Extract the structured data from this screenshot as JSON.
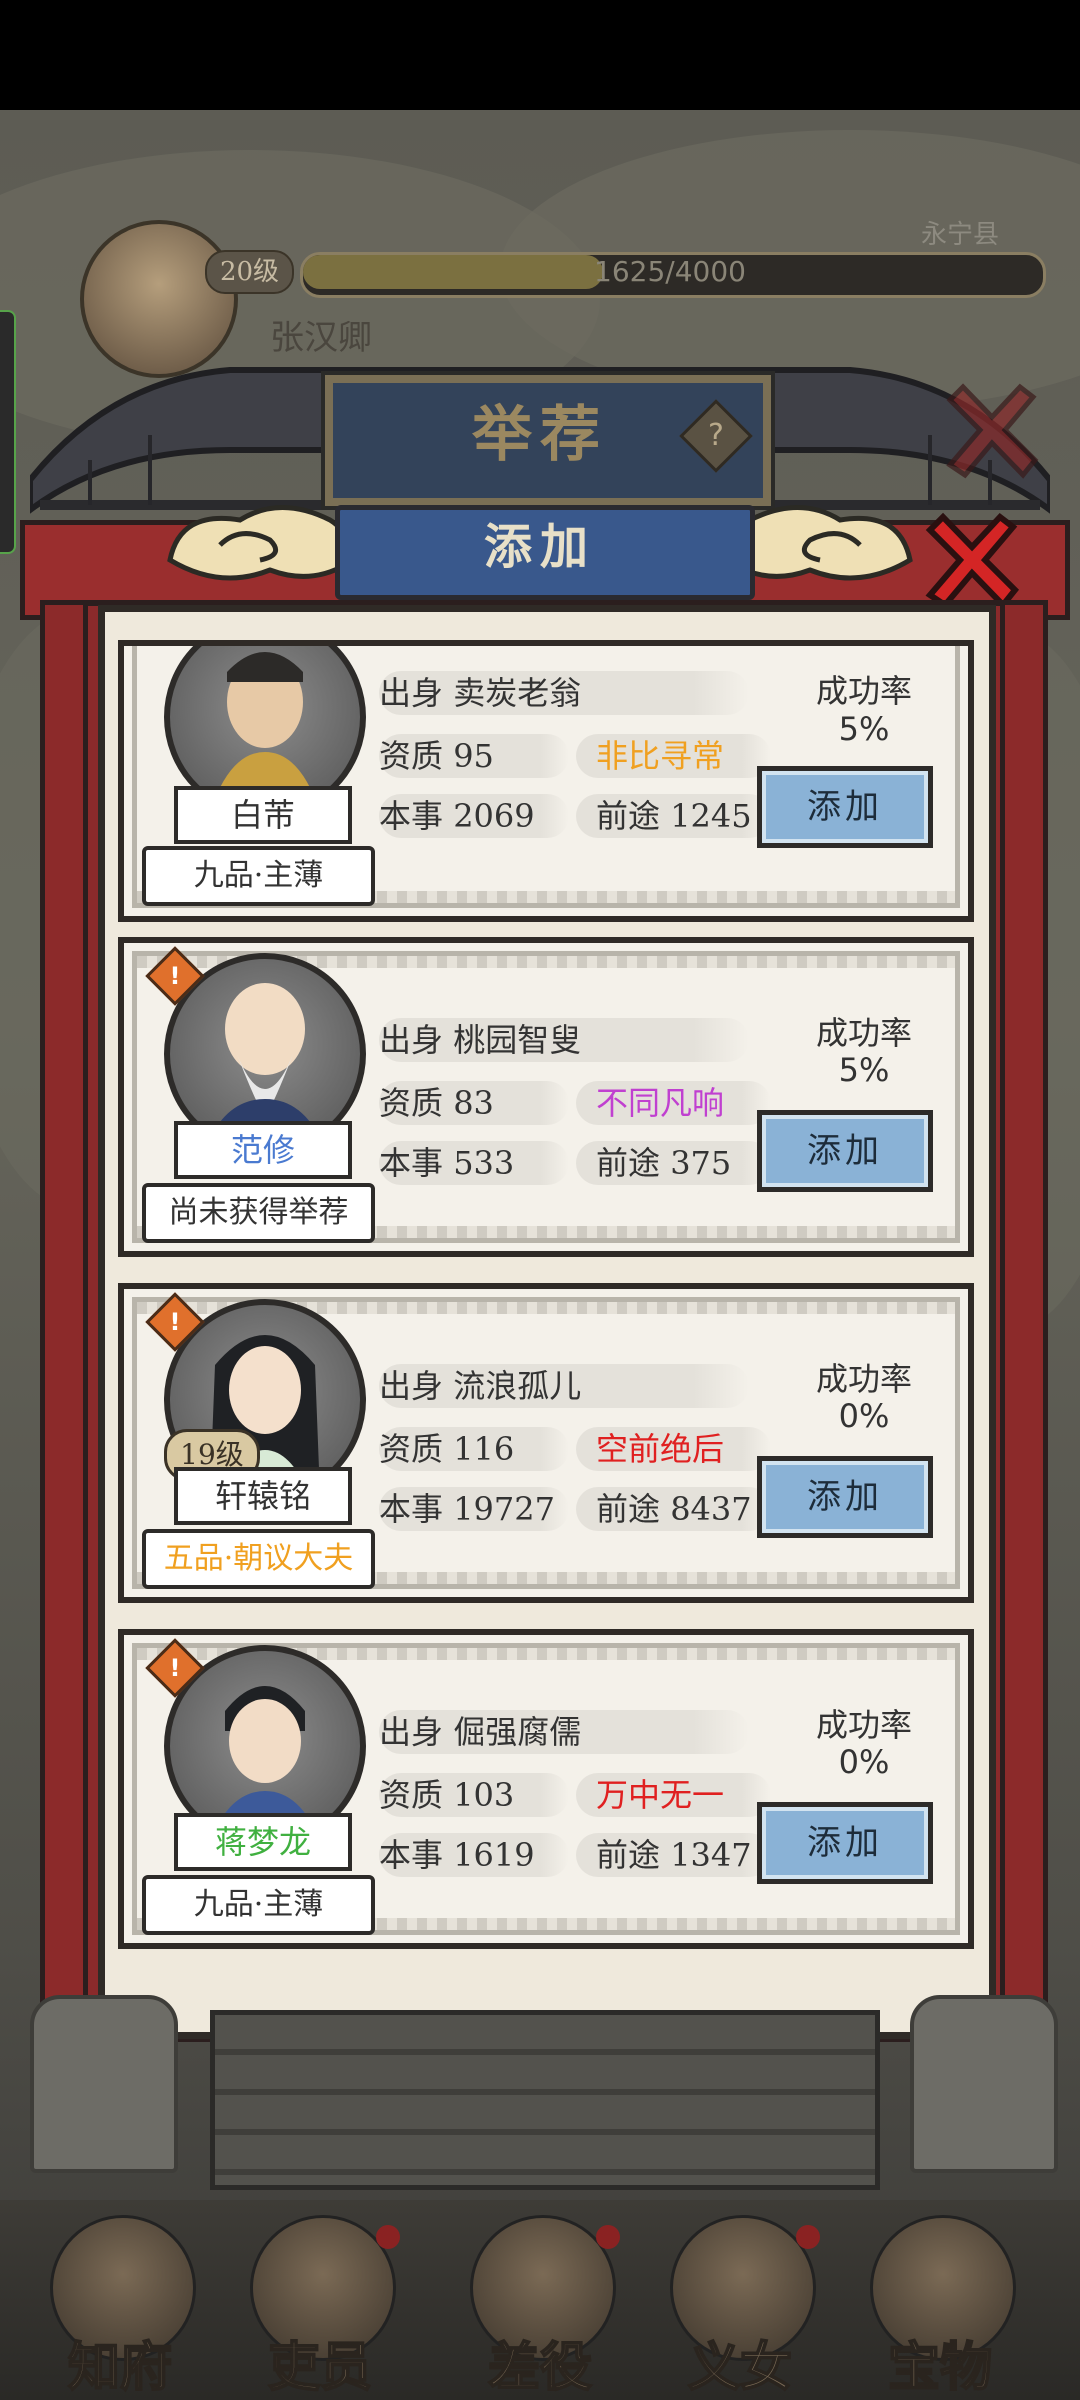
{
  "background": {
    "player_level": "20级",
    "exp_text": "1625/4000",
    "exp_progress": 0.406,
    "county": "永宁县",
    "player_name": "张汉卿"
  },
  "dialog": {
    "title": "举荐",
    "help_icon": "question-icon",
    "subtitle": "添加",
    "close_icon": "close-x-icon"
  },
  "candidates": [
    {
      "origin_label": "出身",
      "origin": "卖炭老翁",
      "aptitude_label": "资质",
      "aptitude": "95",
      "grade": "非比寻常",
      "grade_color": "#f0a020",
      "skill_label": "本事",
      "skill": "2069",
      "prospect_label": "前途",
      "prospect": "1245",
      "name": "白芾",
      "name_color": "#333333",
      "rank": "九品·主薄",
      "rank_color": "#333333",
      "success_label": "成功率",
      "success_rate": "5%",
      "button": "添加",
      "has_warning": false,
      "level": ""
    },
    {
      "origin_label": "出身",
      "origin": "桃园智叟",
      "aptitude_label": "资质",
      "aptitude": "83",
      "grade": "不同凡响",
      "grade_color": "#c040d0",
      "skill_label": "本事",
      "skill": "533",
      "prospect_label": "前途",
      "prospect": "375",
      "name": "范修",
      "name_color": "#4a7ad0",
      "rank": "尚未获得举荐",
      "rank_color": "#333333",
      "success_label": "成功率",
      "success_rate": "5%",
      "button": "添加",
      "has_warning": true,
      "level": ""
    },
    {
      "origin_label": "出身",
      "origin": "流浪孤儿",
      "aptitude_label": "资质",
      "aptitude": "116",
      "grade": "空前绝后",
      "grade_color": "#e02020",
      "skill_label": "本事",
      "skill": "19727",
      "prospect_label": "前途",
      "prospect": "8437",
      "name": "轩辕铭",
      "name_color": "#333333",
      "rank": "五品·朝议大夫",
      "rank_color": "#f0a020",
      "success_label": "成功率",
      "success_rate": "0%",
      "button": "添加",
      "has_warning": true,
      "level": "19级"
    },
    {
      "origin_label": "出身",
      "origin": "倔强腐儒",
      "aptitude_label": "资质",
      "aptitude": "103",
      "grade": "万中无一",
      "grade_color": "#e02020",
      "skill_label": "本事",
      "skill": "1619",
      "prospect_label": "前途",
      "prospect": "1347",
      "name": "蒋梦龙",
      "name_color": "#40b040",
      "rank": "九品·主薄",
      "rank_color": "#333333",
      "success_label": "成功率",
      "success_rate": "0%",
      "button": "添加",
      "has_warning": true,
      "level": ""
    }
  ],
  "nav": [
    {
      "label": "知府"
    },
    {
      "label": "吏员"
    },
    {
      "label": "差役"
    },
    {
      "label": "义女"
    },
    {
      "label": "宝物"
    }
  ]
}
